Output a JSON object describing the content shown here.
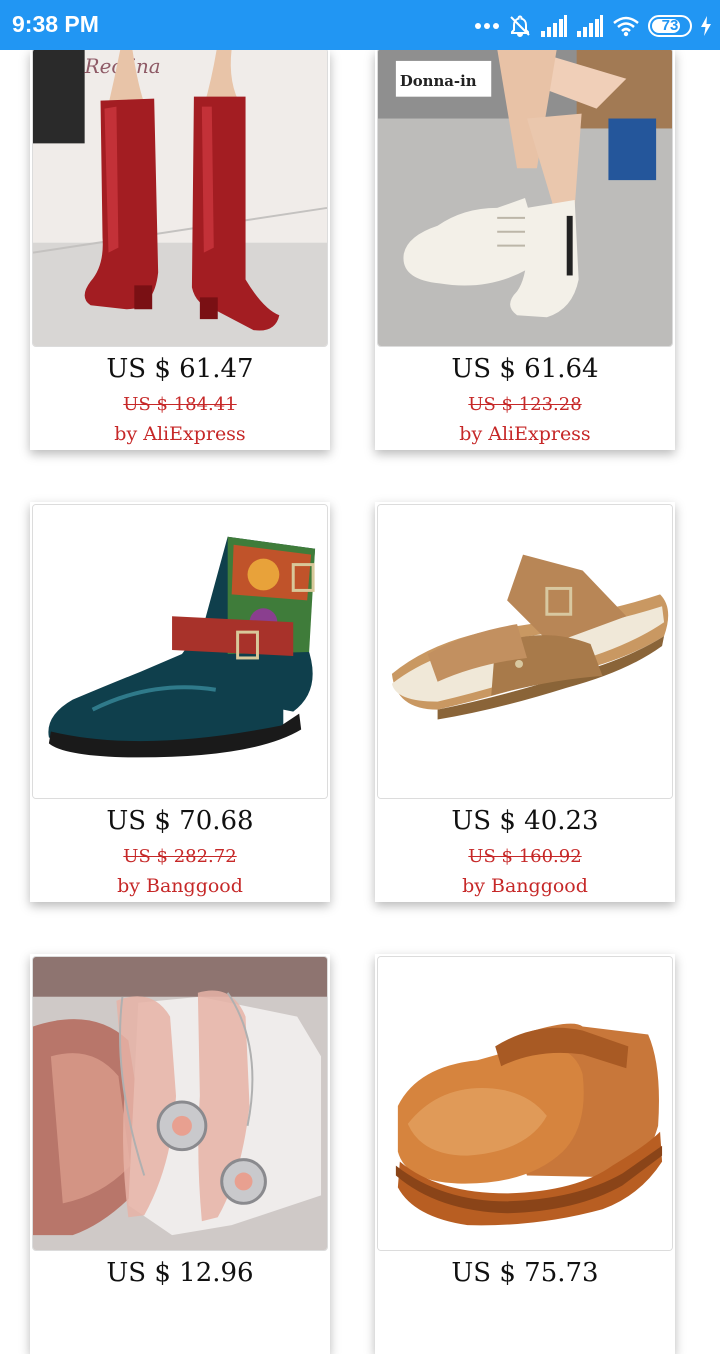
{
  "status_bar": {
    "time": "9:38 PM",
    "battery": "73",
    "icons": [
      "more-dots-icon",
      "notifications-off-icon",
      "signal-icon",
      "signal-icon",
      "wifi-icon",
      "battery-icon",
      "charging-icon"
    ]
  },
  "products": [
    {
      "image": "red-patent-knee-high-boots",
      "price": "US $ 61.47",
      "original_price": "US $ 184.41",
      "seller": "by AliExpress"
    },
    {
      "image": "white-lace-up-ankle-boots",
      "price": "US $ 61.64",
      "original_price": "US $ 123.28",
      "seller": "by AliExpress"
    },
    {
      "image": "patterned-leather-buckle-boots",
      "price": "US $ 70.68",
      "original_price": "US $ 282.72",
      "seller": "by Banggood"
    },
    {
      "image": "brown-buckle-wedge-sandals",
      "price": "US $ 40.23",
      "original_price": "US $ 160.92",
      "seller": "by Banggood"
    },
    {
      "image": "clear-jeweled-stiletto-heels",
      "price": "US $ 12.96",
      "original_price": "",
      "seller": ""
    },
    {
      "image": "tan-leather-platform-shoes",
      "price": "US $ 75.73",
      "original_price": "",
      "seller": ""
    }
  ],
  "brand_marks": {
    "product_1": "Reolina",
    "product_2": "Donna-in"
  },
  "colors": {
    "status_bar": "#2196F3",
    "discount_text": "#c62828"
  }
}
